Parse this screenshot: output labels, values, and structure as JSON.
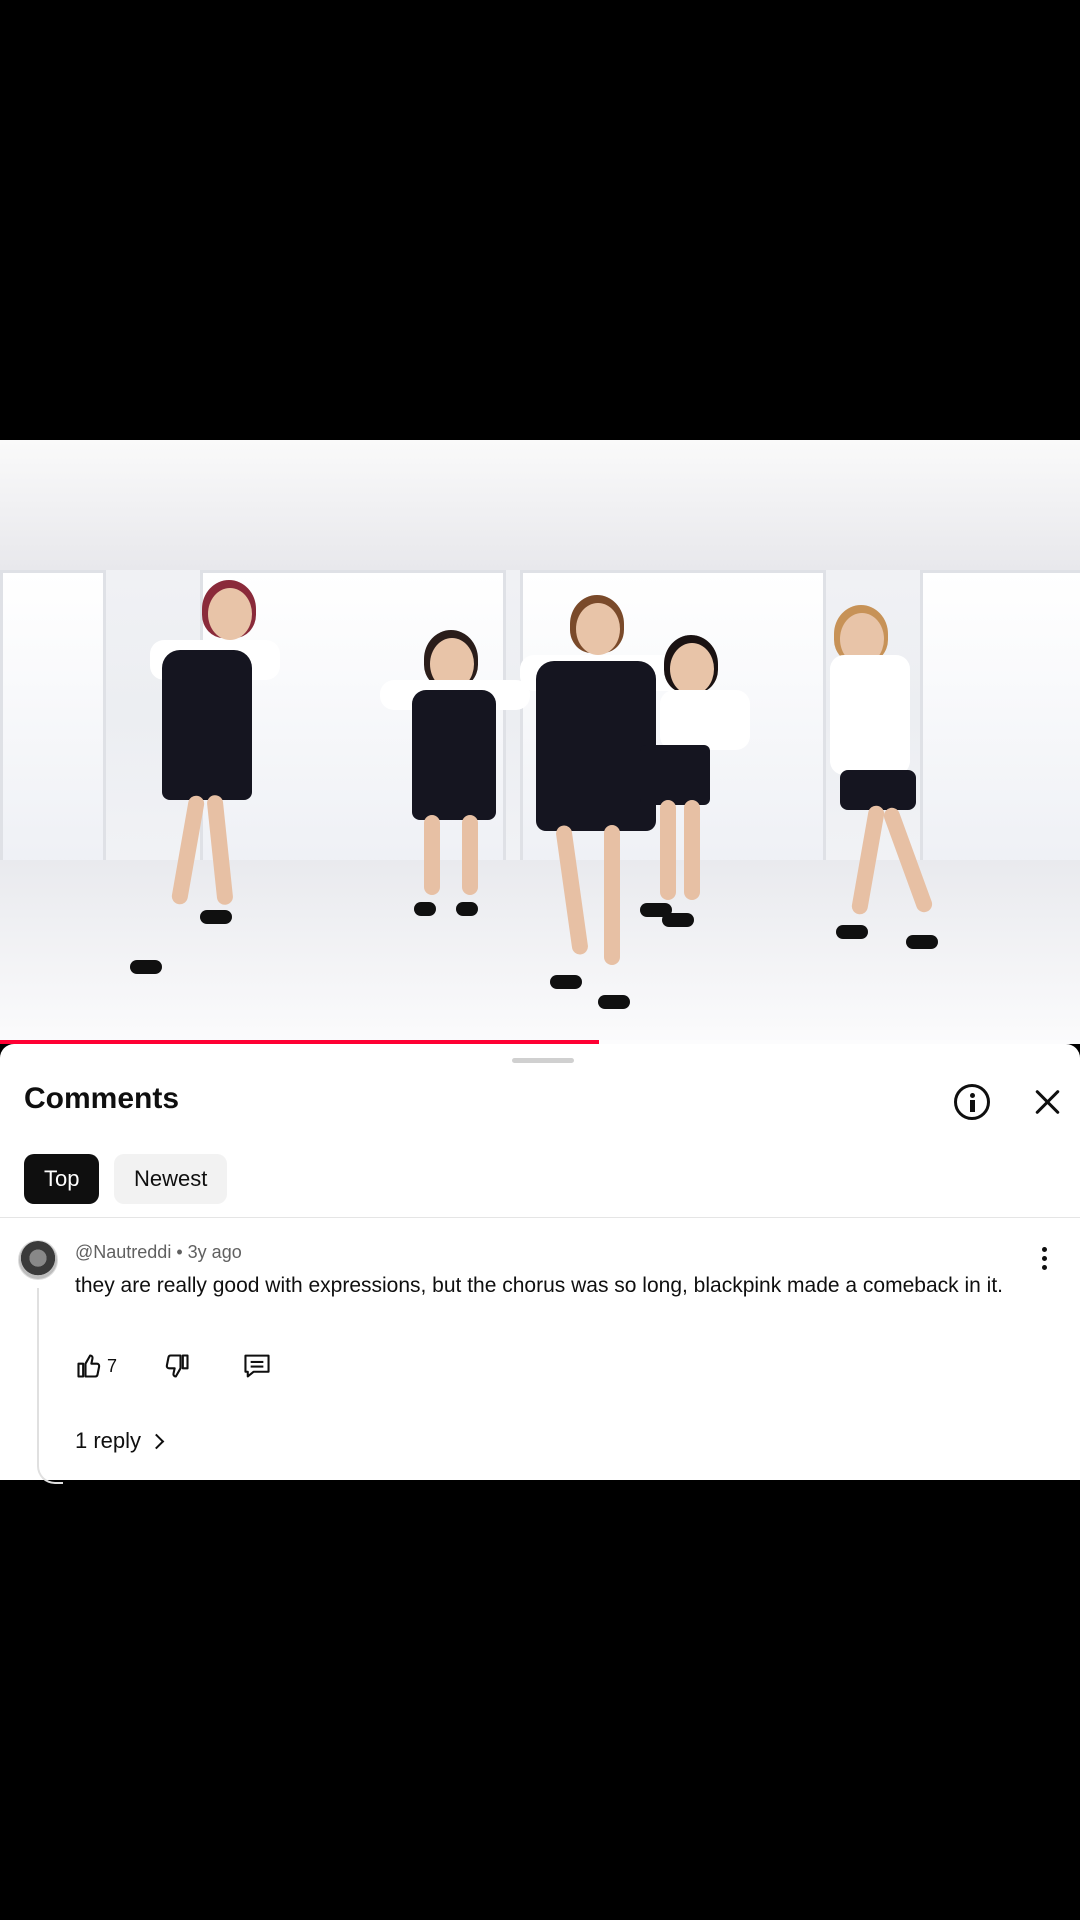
{
  "video": {
    "progress_fraction": 0.555,
    "progress_color": "#ff0033"
  },
  "comments_panel": {
    "title": "Comments",
    "info_icon": "info-icon",
    "close_icon": "close-icon",
    "sort_tabs": [
      {
        "label": "Top",
        "active": true
      },
      {
        "label": "Newest",
        "active": false
      }
    ]
  },
  "comment": {
    "author": "@Nautreddi",
    "separator": "•",
    "age": "3y ago",
    "text": "they are really good with expressions, but the chorus was so long, blackpink made a comeback in it.",
    "likes": "7",
    "replies_label": "1 reply",
    "icons": {
      "like": "thumbs-up-icon",
      "dislike": "thumbs-down-icon",
      "reply": "comment-icon",
      "more": "more-vertical-icon"
    }
  }
}
